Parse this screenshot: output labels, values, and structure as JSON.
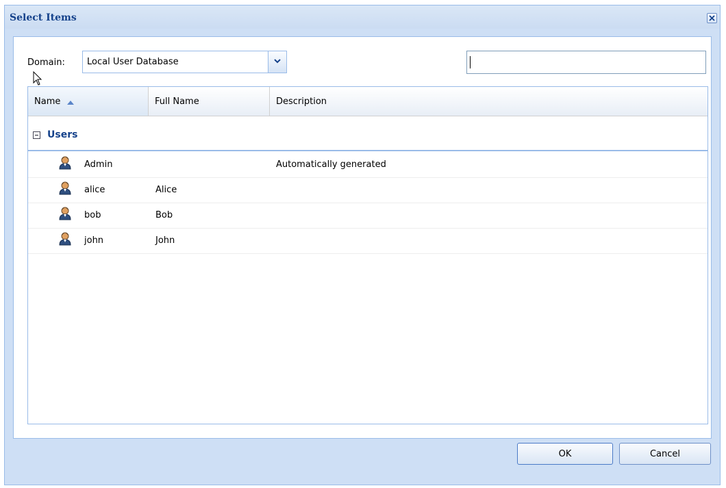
{
  "dialog": {
    "title": "Select Items"
  },
  "domain": {
    "label": "Domain:",
    "selected": "Local User Database"
  },
  "search": {
    "value": ""
  },
  "grid": {
    "columns": [
      {
        "label": "Name",
        "sorted": "ascending"
      },
      {
        "label": "Full Name"
      },
      {
        "label": "Description"
      }
    ],
    "group": {
      "label": "Users",
      "expanded": true
    },
    "rows": [
      {
        "name": "Admin",
        "full_name": "",
        "description": "Automatically generated"
      },
      {
        "name": "alice",
        "full_name": "Alice",
        "description": ""
      },
      {
        "name": "bob",
        "full_name": "Bob",
        "description": ""
      },
      {
        "name": "john",
        "full_name": "John",
        "description": ""
      }
    ]
  },
  "buttons": {
    "ok": "OK",
    "cancel": "Cancel"
  },
  "colors": {
    "title": "#15428b",
    "border": "#99bbe8",
    "window_bg": "#cedff5"
  }
}
